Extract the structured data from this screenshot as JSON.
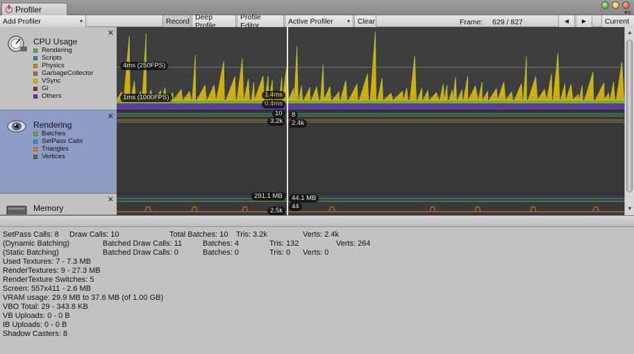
{
  "window": {
    "tab_title": "Profiler",
    "tab_icon": "profiler-icon"
  },
  "toolbar": {
    "add_profiler": "Add Profiler",
    "record": "Record",
    "deep_profile": "Deep Profile",
    "profile_editor": "Profile Editor",
    "active_profiler": "Active Profiler",
    "clear": "Clear",
    "frame_label": "Frame:",
    "frame_value": "629 / 827",
    "prev_icon": "◀",
    "next_icon": "▶",
    "current": "Current"
  },
  "cpu": {
    "title": "CPU Usage",
    "legend": [
      {
        "label": "Rendering",
        "color": "#6fa83a"
      },
      {
        "label": "Scripts",
        "color": "#2f86b8"
      },
      {
        "label": "Physics",
        "color": "#d9822b"
      },
      {
        "label": "GarbageCollector",
        "color": "#8d7b3a"
      },
      {
        "label": "VSync",
        "color": "#e0b800"
      },
      {
        "label": "Gi",
        "color": "#8a3a1c"
      },
      {
        "label": "Others",
        "color": "#5a3c9c"
      }
    ],
    "line_4ms": "4ms (250FPS)",
    "line_1ms": "1ms (1000FPS)",
    "sel_vsync": "1.4ms",
    "sel_others": "0.4ms"
  },
  "rendering": {
    "title": "Rendering",
    "legend": [
      {
        "label": "Batches",
        "color": "#6fa83a"
      },
      {
        "label": "SetPass Calls",
        "color": "#2f9fb8"
      },
      {
        "label": "Triangles",
        "color": "#d9822b"
      },
      {
        "label": "Vertices",
        "color": "#6b6b2b"
      }
    ],
    "sel_left_1": "10",
    "sel_right_1": "8",
    "sel_left_2": "3.2k",
    "sel_right_2": "2.4k"
  },
  "memory": {
    "title": "Memory",
    "sel_left_1": "291.1 MB",
    "sel_right_1": "44.1 MB",
    "sel_right_2": "44",
    "sel_left_2": "2.5k"
  },
  "details": {
    "r1": [
      "SetPass Calls: 8",
      "Draw Calls: 10",
      "Total Batches: 10",
      "Tris: 3.2k",
      "Verts: 2.4k"
    ],
    "r2": [
      "(Dynamic Batching)",
      "Batched Draw Calls: 11",
      "Batches: 4",
      "Tris: 132",
      "Verts: 264"
    ],
    "r3": [
      "(Static Batching)",
      "Batched Draw Calls: 0",
      "Batches: 0",
      "Tris: 0",
      "Verts: 0"
    ],
    "lines": [
      "Used Textures: 7 - 7.3 MB",
      "RenderTextures: 9 - 27.3 MB",
      "RenderTexture Switches: 5",
      "Screen: 557x411 - 2.6 MB",
      "VRAM usage: 29.9 MB to 37.6 MB (of 1.00 GB)",
      "VBO Total: 29 - 343.8 KB",
      "VB Uploads: 0 - 0 B",
      "IB Uploads: 0 - 0 B",
      "Shadow Casters: 8"
    ]
  }
}
